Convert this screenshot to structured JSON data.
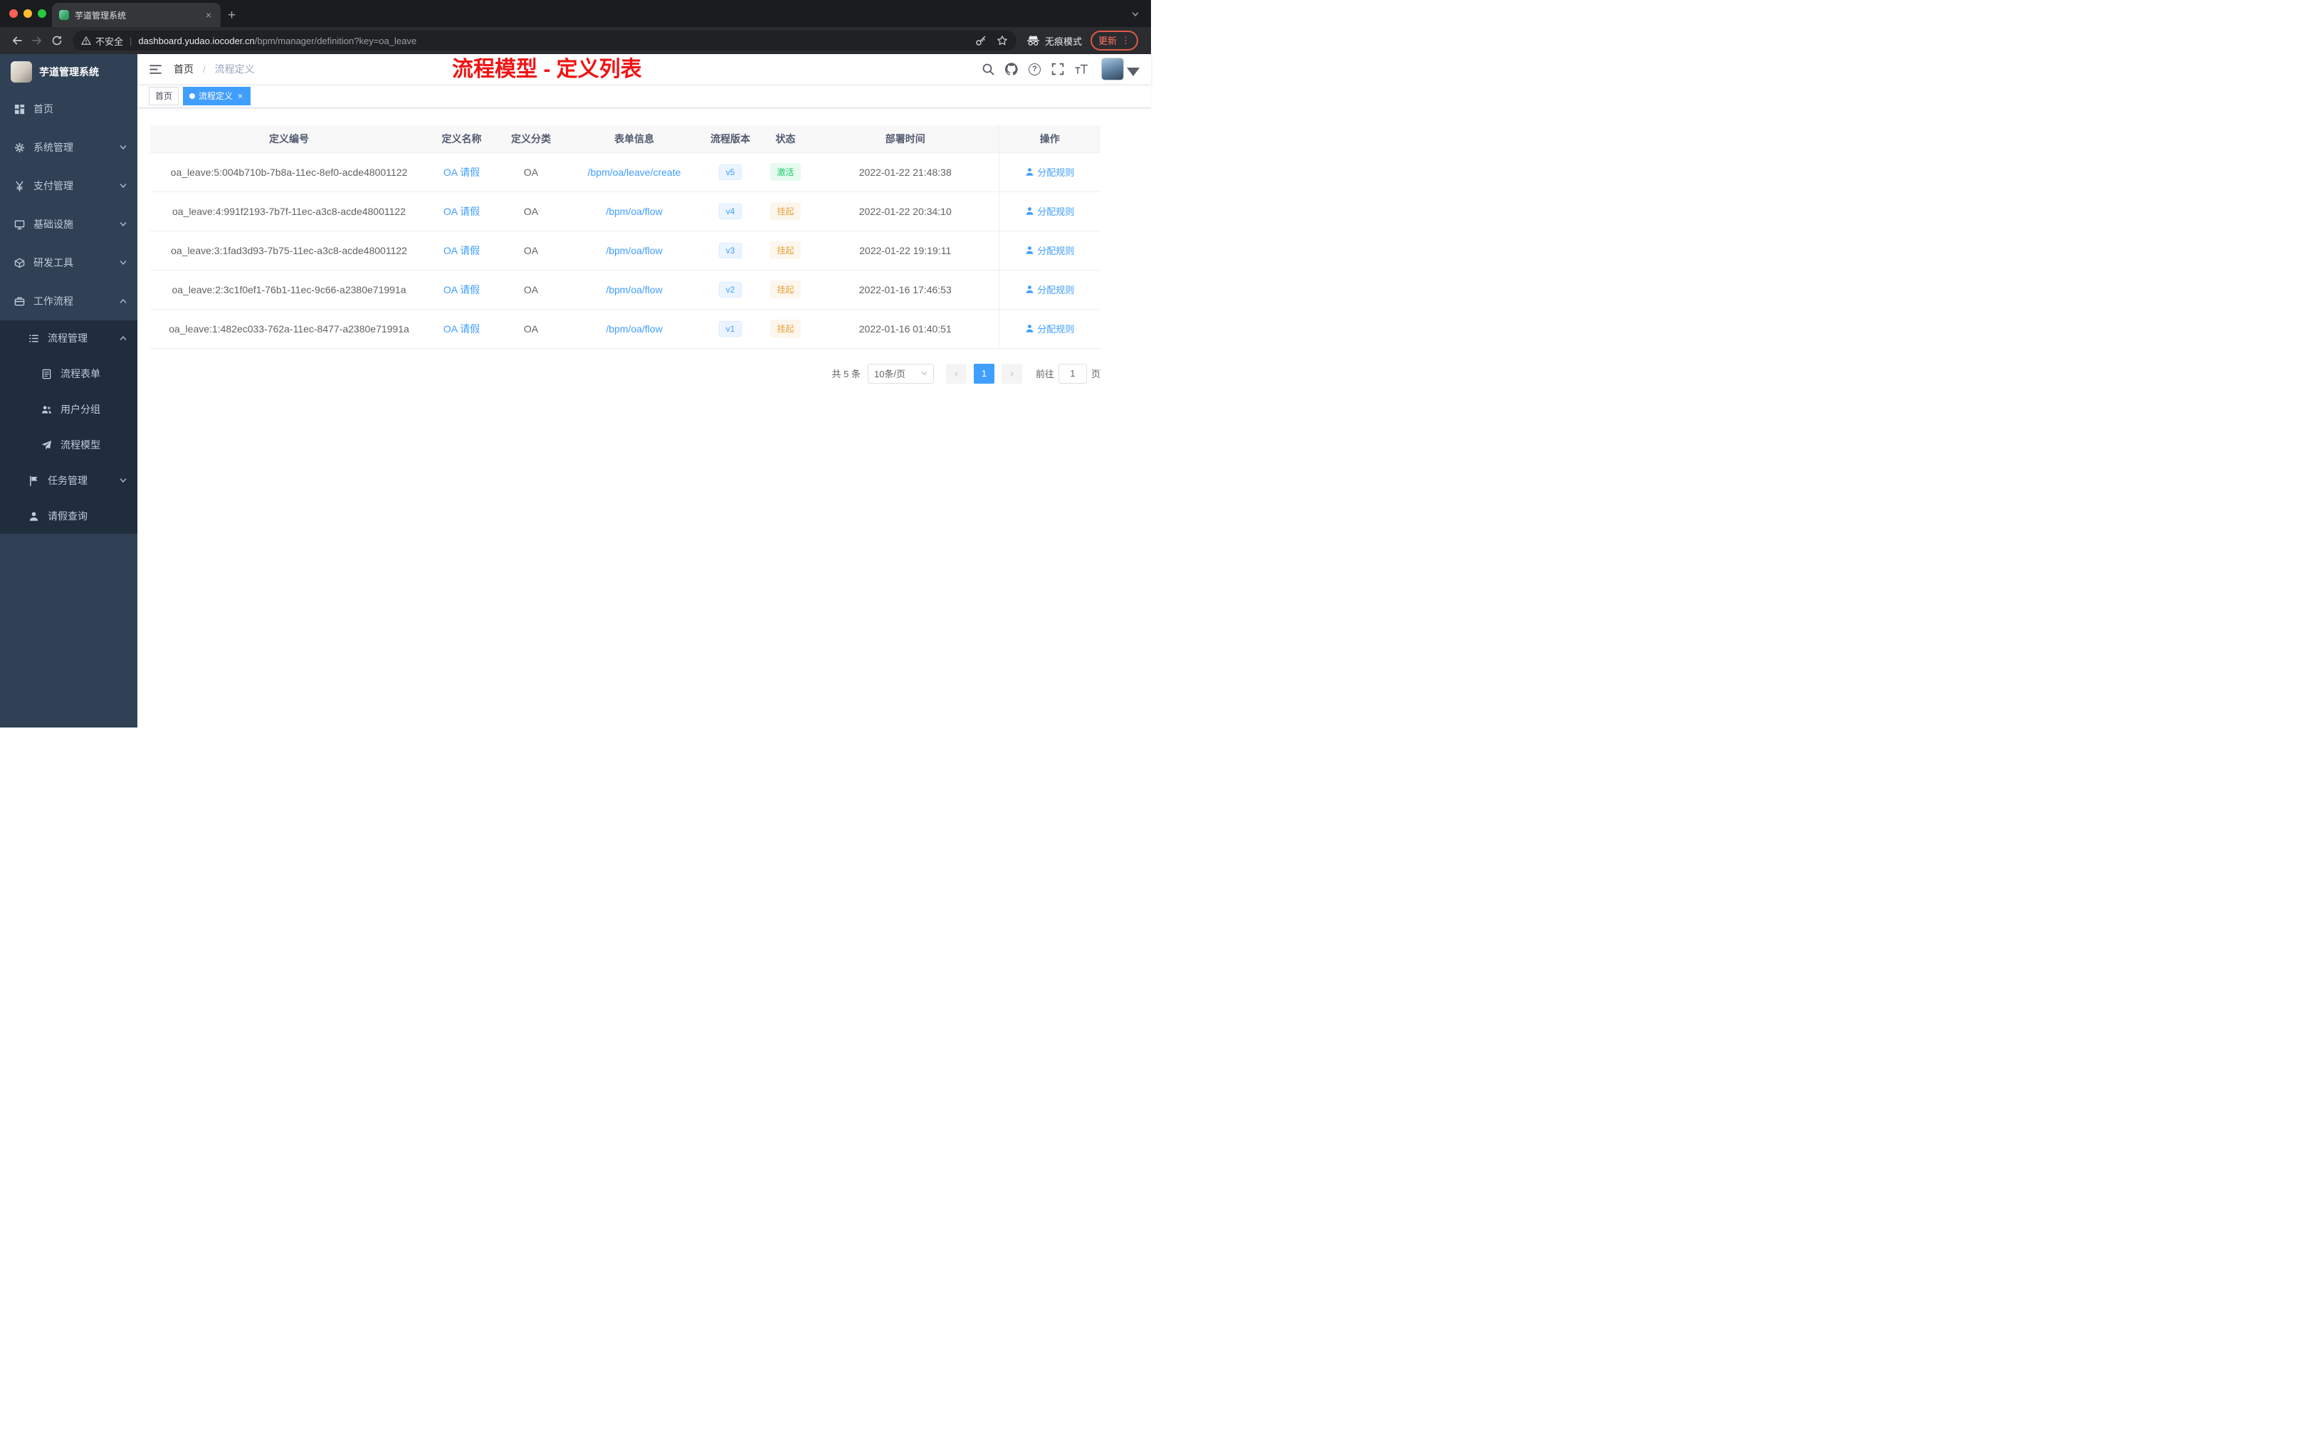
{
  "colors": {
    "accent": "#409eff",
    "annotation_red": "#f01414",
    "success_green": "#13ce66",
    "warning_orange": "#e6a23c",
    "sidebar_bg": "#304156",
    "submenu_bg": "#1f2d3d"
  },
  "browser": {
    "tab": {
      "title": "芋道管理系统"
    },
    "address": {
      "security_label": "不安全",
      "domain": "dashboard.yudao.iocoder.cn",
      "path": "/bpm/manager/definition?key=oa_leave"
    },
    "incognito_label": "无痕模式",
    "update_label": "更新"
  },
  "sidebar": {
    "logo_title": "芋道管理系统",
    "items": [
      {
        "label": "首页",
        "icon": "dashboard",
        "depth": 0,
        "arrow": "none"
      },
      {
        "label": "系统管理",
        "icon": "gear",
        "depth": 0,
        "arrow": "down"
      },
      {
        "label": "支付管理",
        "icon": "yen",
        "depth": 0,
        "arrow": "down"
      },
      {
        "label": "基础设施",
        "icon": "monitor",
        "depth": 0,
        "arrow": "down"
      },
      {
        "label": "研发工具",
        "icon": "box",
        "depth": 0,
        "arrow": "down"
      },
      {
        "label": "工作流程",
        "icon": "briefcase",
        "depth": 0,
        "arrow": "up"
      },
      {
        "label": "流程管理",
        "icon": "list",
        "depth": 1,
        "arrow": "up"
      },
      {
        "label": "流程表单",
        "icon": "doc",
        "depth": 2,
        "arrow": "none"
      },
      {
        "label": "用户分组",
        "icon": "users",
        "depth": 2,
        "arrow": "none"
      },
      {
        "label": "流程模型",
        "icon": "send",
        "depth": 2,
        "arrow": "none"
      },
      {
        "label": "任务管理",
        "icon": "flag",
        "depth": 1,
        "arrow": "down"
      },
      {
        "label": "请假查询",
        "icon": "user",
        "depth": 1,
        "arrow": "none"
      }
    ]
  },
  "header": {
    "breadcrumb_root": "首页",
    "breadcrumb_sep": "/",
    "breadcrumb_current": "流程定义",
    "annotation": "流程模型 - 定义列表"
  },
  "tags": [
    {
      "label": "首页",
      "state": "normal"
    },
    {
      "label": "流程定义",
      "state": "active"
    }
  ],
  "table": {
    "columns": [
      "定义编号",
      "定义名称",
      "定义分类",
      "表单信息",
      "流程版本",
      "状态",
      "部署时间",
      "操作"
    ],
    "rows": [
      {
        "id": "oa_leave:5:004b710b-7b8a-11ec-8ef0-acde48001122",
        "name": "OA 请假",
        "category": "OA",
        "form": "/bpm/oa/leave/create",
        "version": "v5",
        "status": "激活",
        "status_type": "success",
        "time": "2022-01-22 21:48:38",
        "action": "分配规则"
      },
      {
        "id": "oa_leave:4:991f2193-7b7f-11ec-a3c8-acde48001122",
        "name": "OA 请假",
        "category": "OA",
        "form": "/bpm/oa/flow",
        "version": "v4",
        "status": "挂起",
        "status_type": "warning",
        "time": "2022-01-22 20:34:10",
        "action": "分配规则"
      },
      {
        "id": "oa_leave:3:1fad3d93-7b75-11ec-a3c8-acde48001122",
        "name": "OA 请假",
        "category": "OA",
        "form": "/bpm/oa/flow",
        "version": "v3",
        "status": "挂起",
        "status_type": "warning",
        "time": "2022-01-22 19:19:11",
        "action": "分配规则"
      },
      {
        "id": "oa_leave:2:3c1f0ef1-76b1-11ec-9c66-a2380e71991a",
        "name": "OA 请假",
        "category": "OA",
        "form": "/bpm/oa/flow",
        "version": "v2",
        "status": "挂起",
        "status_type": "warning",
        "time": "2022-01-16 17:46:53",
        "action": "分配规则"
      },
      {
        "id": "oa_leave:1:482ec033-762a-11ec-8477-a2380e71991a",
        "name": "OA 请假",
        "category": "OA",
        "form": "/bpm/oa/flow",
        "version": "v1",
        "status": "挂起",
        "status_type": "warning",
        "time": "2022-01-16 01:40:51",
        "action": "分配规则"
      }
    ]
  },
  "pagination": {
    "total": "共 5 条",
    "page_size": "10条/页",
    "prev": "‹",
    "current_page": "1",
    "next": "›",
    "goto_label": "前往",
    "goto_value": "1",
    "goto_unit": "页"
  }
}
